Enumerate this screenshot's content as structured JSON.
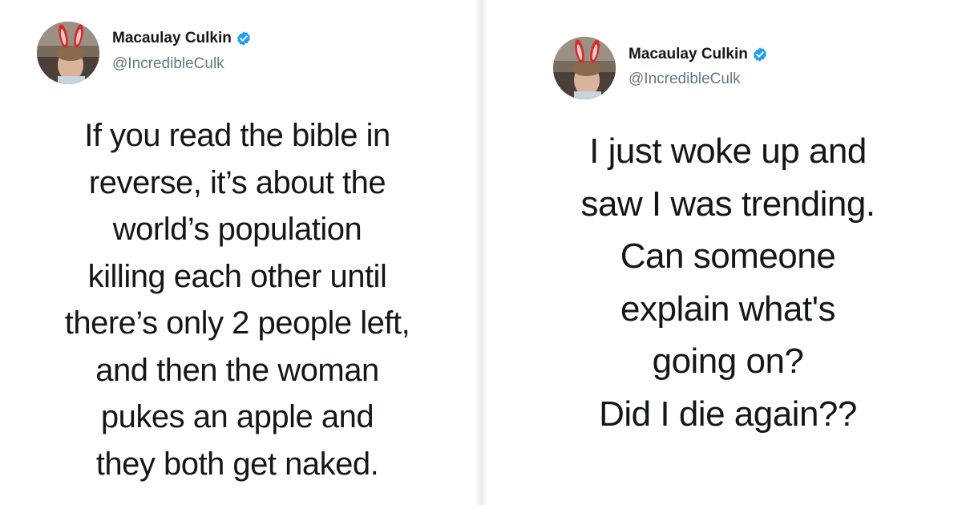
{
  "tweets": [
    {
      "author": {
        "name": "Macaulay Culkin",
        "handle": "@IncredibleCulk",
        "verified": true
      },
      "lines": [
        "If you read the bible in",
        "reverse, it’s about the",
        "world’s population",
        "killing each other until",
        "there’s only 2 people left,",
        "and then the woman",
        "pukes an apple and",
        "they both get naked."
      ]
    },
    {
      "author": {
        "name": "Macaulay Culkin",
        "handle": "@IncredibleCulk",
        "verified": true
      },
      "lines": [
        "I just woke up and",
        "saw I was trending.",
        "Can someone",
        "explain what's",
        "going on?",
        "Did I die again??"
      ]
    }
  ],
  "colors": {
    "verified_badge": "#1da1f2",
    "handle": "#657786",
    "text": "#14171a"
  },
  "icons": {
    "verified": "verified-badge-icon",
    "avatar": "bunny-ears-avatar"
  }
}
